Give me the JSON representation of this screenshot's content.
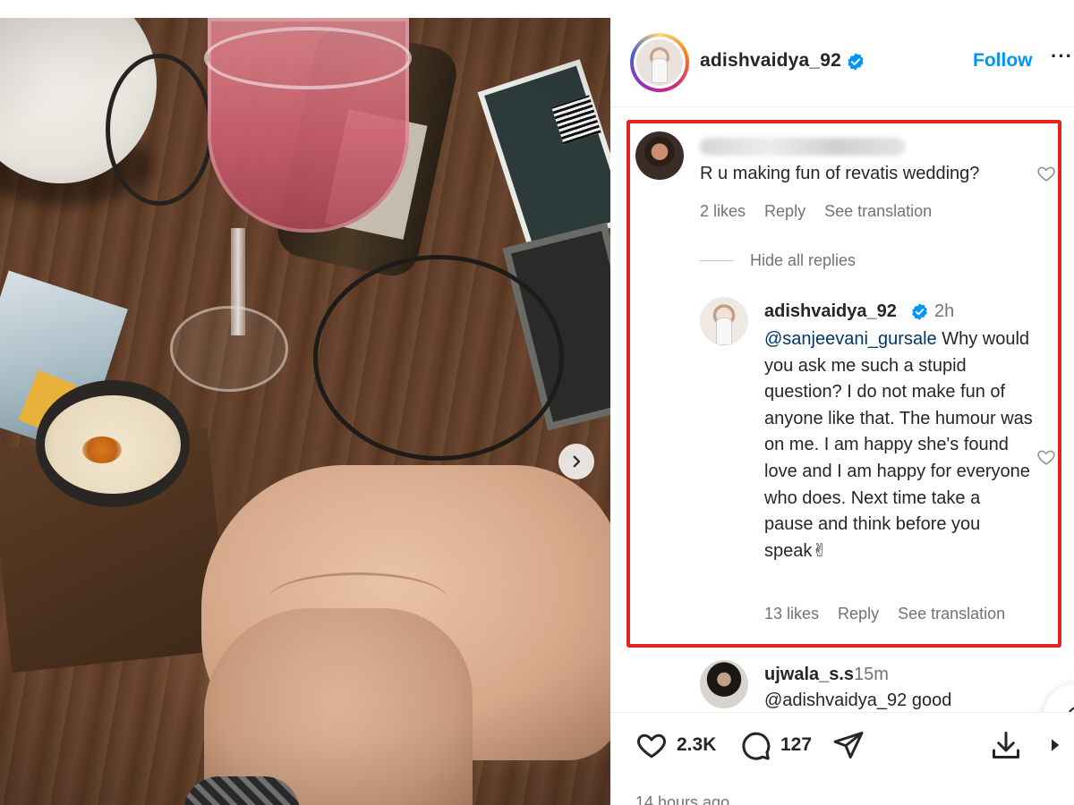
{
  "post": {
    "author": "adishvaidya_92",
    "follow_label": "Follow",
    "more_label": "···"
  },
  "comments": [
    {
      "username": "",
      "text": "R u making fun of revatis wedding?",
      "likes": "2 likes",
      "reply_label": "Reply",
      "translate_label": "See translation"
    }
  ],
  "hide_replies_label": "Hide all replies",
  "reply": {
    "username": "adishvaidya_92",
    "time": "2h",
    "mention": "@sanjeevani_gursale",
    "text": " Why would you ask me such a stupid question? I do not make fun of anyone like that. The humour was on me. I am happy she's found love and I am happy for everyone who does. Next time take a pause and think before you speak✌",
    "likes": "13 likes",
    "reply_label": "Reply",
    "translate_label": "See translation"
  },
  "next_comment": {
    "username": "ujwala_s.s",
    "time": "15m",
    "text": "@adishvaidya_92 good"
  },
  "actions": {
    "likes": "2.3K",
    "comments": "127"
  },
  "posted": "14 hours ago",
  "colors": {
    "link": "#0095f6",
    "mention": "#00376b",
    "highlight": "#e32222",
    "muted": "#737373",
    "verified": "#0095f6"
  },
  "icons": [
    "verified-badge-icon",
    "heart-icon",
    "comment-icon",
    "share-icon",
    "save-icon",
    "chevron-right-icon"
  ]
}
